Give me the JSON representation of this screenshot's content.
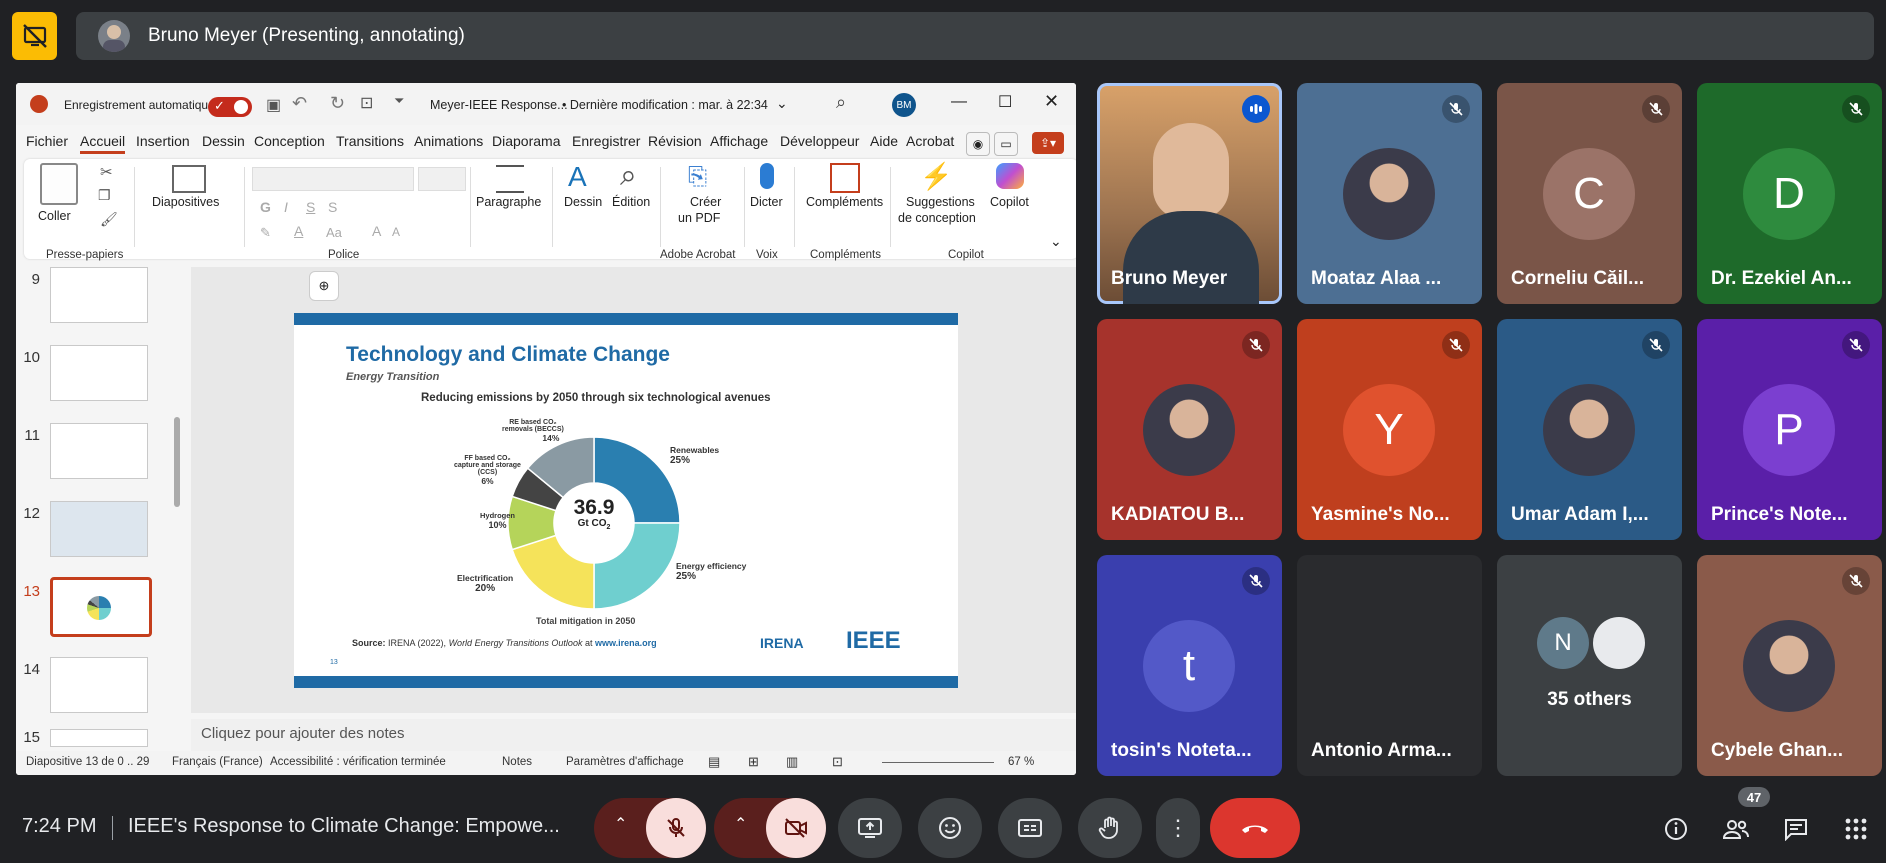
{
  "presenter_bar": {
    "title": "Bruno Meyer (Presenting, annotating)"
  },
  "ppt": {
    "autosave_label": "Enregistrement automatique",
    "doc_title": "Meyer-IEEE Response...",
    "last_modified": "• Dernière modification : mar. à 22:34",
    "user_initials": "BM",
    "tabs": [
      "Fichier",
      "Accueil",
      "Insertion",
      "Dessin",
      "Conception",
      "Transitions",
      "Animations",
      "Diaporama",
      "Enregistrer",
      "Révision",
      "Affichage",
      "Développeur",
      "Aide",
      "Acrobat"
    ],
    "ribbon": {
      "paste": "Coller",
      "slides": "Diapositives",
      "paragraph": "Paragraphe",
      "draw": "Dessin",
      "edit": "Édition",
      "pdf_1": "Créer",
      "pdf_2": "un PDF",
      "dictate": "Dicter",
      "addins": "Compléments",
      "design_1": "Suggestions",
      "design_2": "de conception",
      "copilot": "Copilot",
      "groups": {
        "clipboard": "Presse-papiers",
        "font": "Police",
        "acrobat": "Adobe Acrobat",
        "voice": "Voix",
        "addins": "Compléments",
        "copilot": "Copilot"
      },
      "font_buttons": {
        "bold": "G",
        "italic": "I",
        "underline": "S",
        "strike": "S",
        "case": "Aa",
        "grow": "A",
        "shrink": "A"
      }
    },
    "thumb_numbers": [
      "9",
      "10",
      "11",
      "12",
      "13",
      "14",
      "15"
    ],
    "notes_placeholder": "Cliquez pour ajouter des notes",
    "status": {
      "slide_count": "Diapositive 13 de 0 .. 29",
      "language": "Français (France)",
      "accessibility": "Accessibilité : vérification terminée",
      "notes": "Notes",
      "display": "Paramètres d'affichage",
      "zoom": "67 %"
    }
  },
  "slide": {
    "title": "Technology and Climate Change",
    "subtitle": "Energy Transition",
    "chart_title": "Reducing emissions by 2050 through six technological avenues",
    "center_value": "36.9",
    "center_unit": "Gt CO",
    "center_sub": "2",
    "segments": [
      {
        "label": "Renewables",
        "pct": "25%",
        "value": 25,
        "color": "#2a7fb0"
      },
      {
        "label": "Energy efficiency",
        "pct": "25%",
        "value": 25,
        "color": "#6fcfcf"
      },
      {
        "label": "Electrification",
        "pct": "20%",
        "value": 20,
        "color": "#f5e35a"
      },
      {
        "label": "Hydrogen",
        "pct": "10%",
        "value": 10,
        "color": "#b5d45a"
      },
      {
        "label_lines": [
          "FF based CO₂",
          "capture and storage",
          "(CCS)"
        ],
        "pct": "6%",
        "value": 6,
        "color": "#444444"
      },
      {
        "label_lines": [
          "RE based CO₂",
          "removals (BECCS)"
        ],
        "pct": "14%",
        "value": 14,
        "color": "#8a9aa3"
      }
    ],
    "total_label": "Total mitigation in 2050",
    "source_bold": "Source:",
    "source_text": "IRENA (2022), ",
    "source_italic": "World Energy Transitions Outlook",
    "source_at": " at ",
    "source_url": "www.irena.org",
    "page_no": "13",
    "logo_irena": "IRENA",
    "logo_ieee": "IEEE"
  },
  "participants": [
    {
      "name": "Bruno Meyer",
      "kind": "video",
      "bg": "#b8865a",
      "speaking": true
    },
    {
      "name": "Moataz Alaa ...",
      "kind": "photo",
      "bg": "#4d6f93",
      "muted": true
    },
    {
      "name": "Corneliu Căil...",
      "kind": "initial",
      "initial": "C",
      "bg": "#7a5548",
      "circle": "#9b7368",
      "muted": true
    },
    {
      "name": "Dr. Ezekiel An...",
      "kind": "initial",
      "initial": "D",
      "bg": "#1e6a2a",
      "circle": "#2e8b3e",
      "muted": true
    },
    {
      "name": "KADIATOU B...",
      "kind": "photo",
      "bg": "#a6332c",
      "muted": true
    },
    {
      "name": "Yasmine's No...",
      "kind": "initial",
      "initial": "Y",
      "bg": "#bf3f1e",
      "circle": "#e0522e",
      "muted": true
    },
    {
      "name": "Umar Adam I,...",
      "kind": "photo",
      "bg": "#2b5a86",
      "muted": true
    },
    {
      "name": "Prince's Note...",
      "kind": "initial",
      "initial": "P",
      "bg": "#5a1fa8",
      "circle": "#7b3fd0",
      "muted": true
    },
    {
      "name": "tosin's Noteta...",
      "kind": "initial",
      "initial": "t",
      "bg": "#3a3fae",
      "circle": "#5359c8",
      "muted": true
    },
    {
      "name": "Antonio Arma...",
      "kind": "dark",
      "bg": "#2a2b2e",
      "muted": false
    },
    {
      "name": "35 others",
      "kind": "others",
      "bg": "#3c4043",
      "initial": "N"
    },
    {
      "name": "Cybele Ghan...",
      "kind": "photo",
      "bg": "#8a5a4a",
      "muted": true
    }
  ],
  "bottom": {
    "time": "7:24 PM",
    "meeting": "IEEE's Response to Climate Change: Empowe...",
    "people_count": "47"
  }
}
